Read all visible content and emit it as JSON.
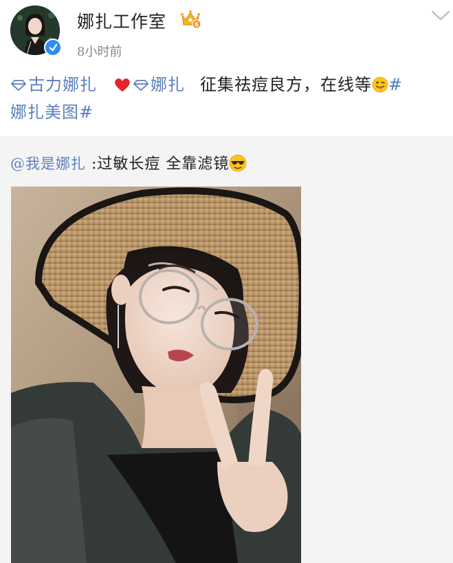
{
  "post": {
    "username": "娜扎工作室",
    "time": "8小时前",
    "verified": true,
    "topic_1": "古力娜扎",
    "topic_2": "娜扎",
    "text": "征集祛痘良方，在线等",
    "topic_end_hash": "#",
    "topic_3": "娜扎美图#"
  },
  "retweet": {
    "mention": "@我是娜扎",
    "text": ":过敏长痘 全靠滤镜"
  },
  "icons": {
    "avatar": "profile-avatar",
    "verified": "verified-badge-icon",
    "vip": "vip-crown-badge-icon",
    "dropdown": "chevron-down-icon",
    "topic": "diamond-icon",
    "heart": "heart-icon",
    "tongue_emoji": "tongue-out-emoji",
    "sunglasses_emoji": "sunglasses-emoji"
  },
  "colors": {
    "link": "#5b7fbd",
    "verified": "#2e8ef0",
    "heart": "#e8232f",
    "retweet_bg": "#f4f4f4"
  }
}
